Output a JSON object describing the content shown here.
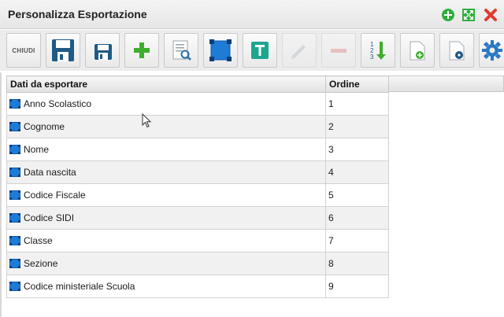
{
  "window": {
    "title": "Personalizza Esportazione",
    "controls": [
      {
        "name": "window-add-icon",
        "color": "#2fae3c"
      },
      {
        "name": "window-maximize-icon",
        "color": "#2fae3c"
      },
      {
        "name": "window-close-icon",
        "color": "#e03a2e"
      }
    ]
  },
  "toolbar": {
    "close_label": "CHIUDI",
    "buttons": [
      {
        "icon": "close-text",
        "label": "CHIUDI"
      },
      {
        "icon": "save-icon"
      },
      {
        "icon": "save-small-icon"
      },
      {
        "icon": "add-icon"
      },
      {
        "icon": "preview-icon"
      },
      {
        "icon": "select-field-icon"
      },
      {
        "icon": "text-icon"
      },
      {
        "icon": "edit-icon",
        "disabled": true
      },
      {
        "icon": "remove-icon",
        "disabled": true
      },
      {
        "icon": "sort-order-icon"
      },
      {
        "icon": "document-add-icon"
      },
      {
        "icon": "document-info-icon"
      },
      {
        "icon": "settings-icon"
      }
    ]
  },
  "grid": {
    "columns": [
      "Dati da esportare",
      "Ordine"
    ],
    "rows": [
      {
        "field": "Anno Scolastico",
        "order": "1"
      },
      {
        "field": "Cognome",
        "order": "2"
      },
      {
        "field": "Nome",
        "order": "3"
      },
      {
        "field": "Data nascita",
        "order": "4"
      },
      {
        "field": "Codice Fiscale",
        "order": "5"
      },
      {
        "field": "Codice SIDI",
        "order": "6"
      },
      {
        "field": "Classe",
        "order": "7"
      },
      {
        "field": "Sezione",
        "order": "8"
      },
      {
        "field": "Codice ministeriale Scuola",
        "order": "9"
      }
    ]
  }
}
